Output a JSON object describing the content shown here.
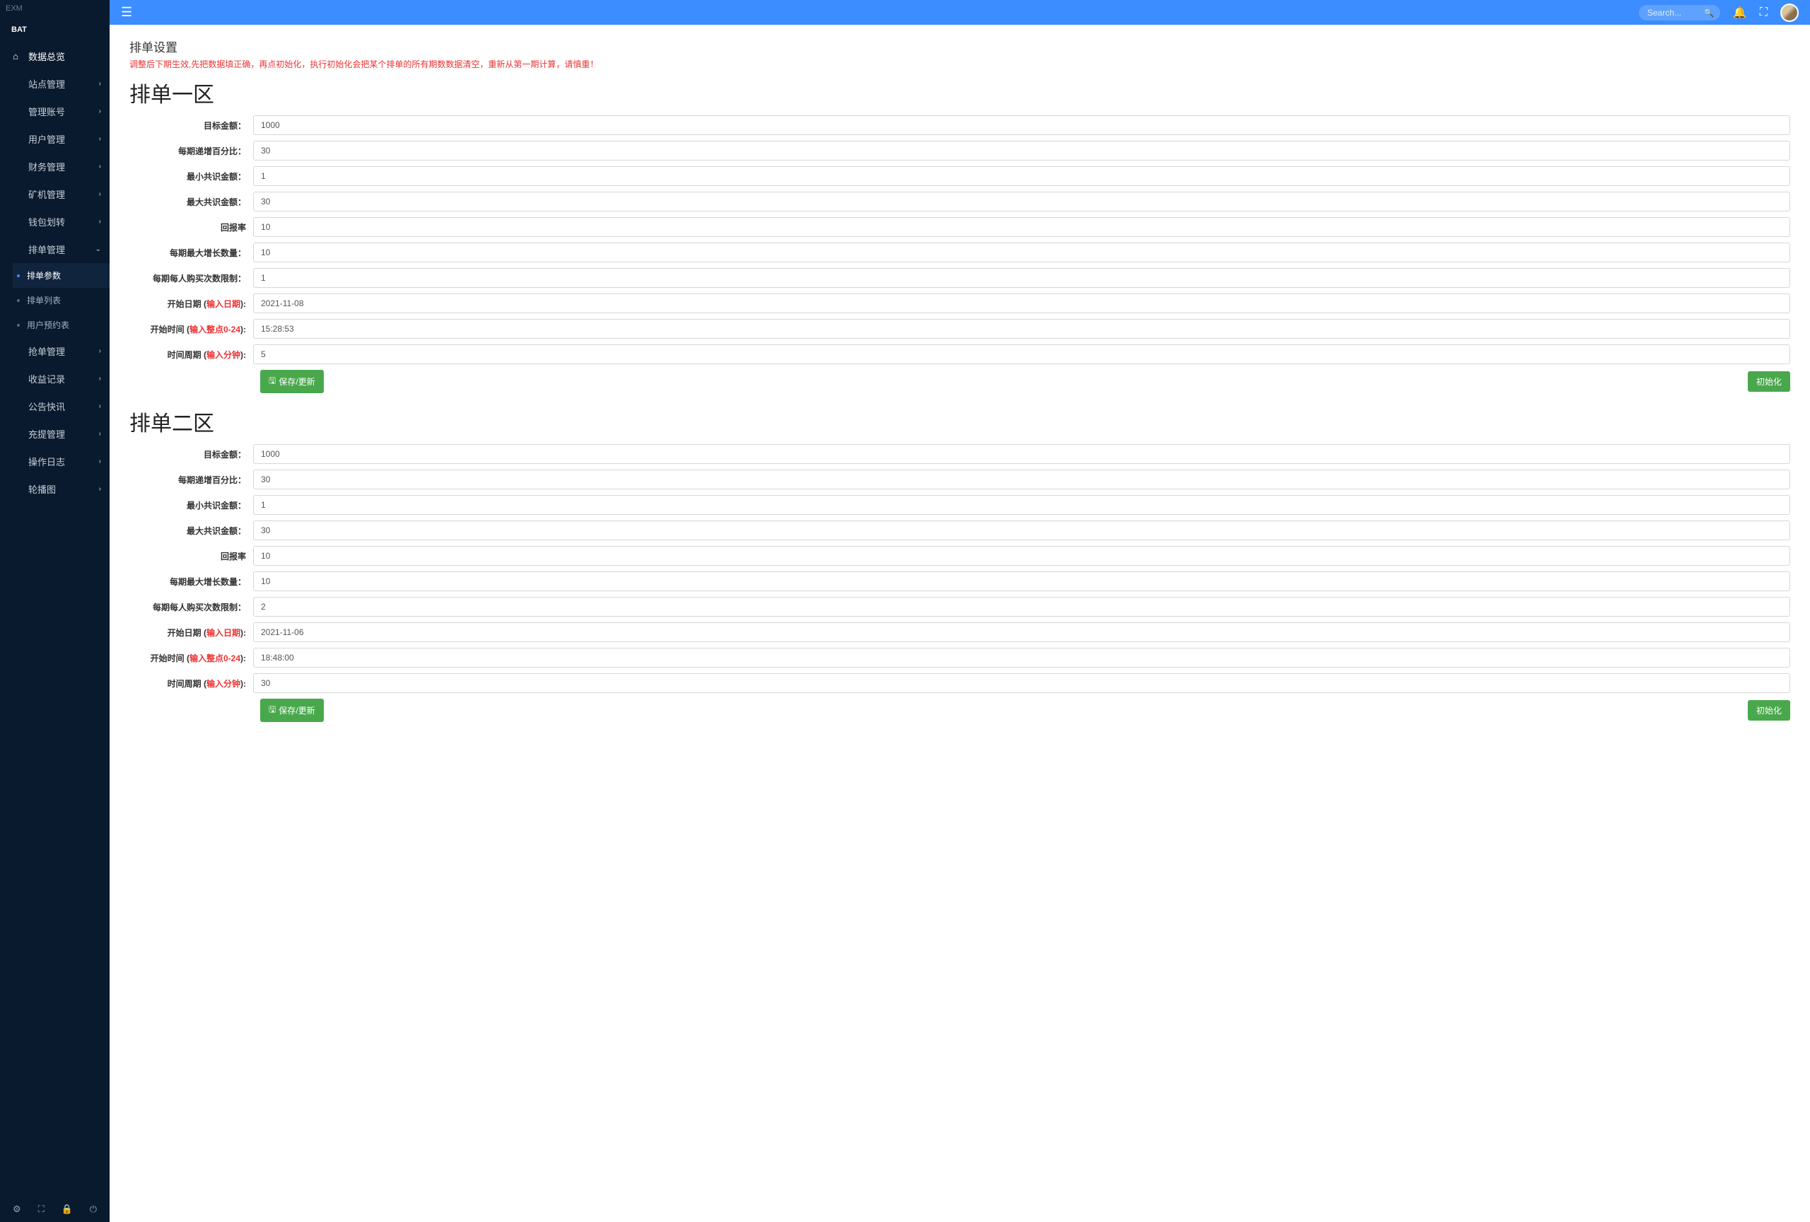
{
  "app_tag": "EXM",
  "brand": "BAT",
  "search": {
    "placeholder": "Search..."
  },
  "nav": {
    "overview": "数据总览",
    "items": [
      {
        "label": "站点管理"
      },
      {
        "label": "管理账号"
      },
      {
        "label": "用户管理"
      },
      {
        "label": "财务管理"
      },
      {
        "label": "矿机管理"
      },
      {
        "label": "钱包划转"
      }
    ],
    "paidan": {
      "label": "排单管理",
      "children": [
        {
          "label": "排单参数"
        },
        {
          "label": "排单列表"
        },
        {
          "label": "用户预约表"
        }
      ]
    },
    "items2": [
      {
        "label": "抢单管理"
      },
      {
        "label": "收益记录"
      },
      {
        "label": "公告快讯"
      },
      {
        "label": "充提管理"
      },
      {
        "label": "操作日志"
      },
      {
        "label": "轮播图"
      }
    ]
  },
  "page": {
    "title": "排单设置",
    "desc": "调整后下期生效,先把数据填正确，再点初始化，执行初始化会把某个排单的所有期数数据清空，重新从第一期计算，请慎重！"
  },
  "labels": {
    "target_amount": "目标金额：",
    "increment_pct": "每期递增百分比：",
    "min_consensus": "最小共识金额：",
    "max_consensus": "最大共识金额：",
    "return_rate": "回报率",
    "max_growth": "每期最大增长数量：",
    "buy_limit": "每期每人购买次数限制：",
    "start_date": "开始日期 (",
    "start_date_hint": "输入日期",
    "start_time": "开始时间 (",
    "start_time_hint": "输入整点0-24",
    "cycle": "时间周期 (",
    "cycle_hint": "输入分钟",
    "label_close": "):"
  },
  "buttons": {
    "save": "保存/更新",
    "init": "初始化"
  },
  "zone1": {
    "title": "排单一区",
    "target_amount": "1000",
    "increment_pct": "30",
    "min_consensus": "1",
    "max_consensus": "30",
    "return_rate": "10",
    "max_growth": "10",
    "buy_limit": "1",
    "start_date": "2021-11-08",
    "start_time": "15:28:53",
    "cycle": "5"
  },
  "zone2": {
    "title": "排单二区",
    "target_amount": "1000",
    "increment_pct": "30",
    "min_consensus": "1",
    "max_consensus": "30",
    "return_rate": "10",
    "max_growth": "10",
    "buy_limit": "2",
    "start_date": "2021-11-06",
    "start_time": "18:48:00",
    "cycle": "30"
  }
}
